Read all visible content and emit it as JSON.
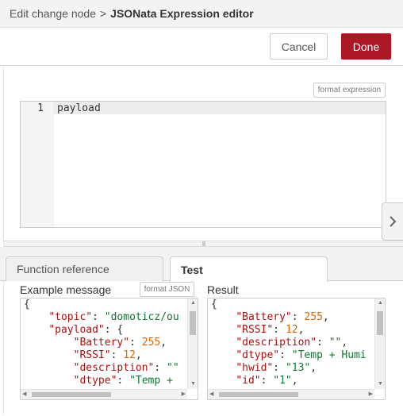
{
  "breadcrumb": {
    "parent": "Edit change node",
    "separator": ">",
    "current": "JSONata Expression editor"
  },
  "toolbar": {
    "cancel_label": "Cancel",
    "done_label": "Done"
  },
  "expression": {
    "format_label": "format expression",
    "line_number": "1",
    "code": "payload"
  },
  "tabs": [
    {
      "label": "Function reference",
      "active": false
    },
    {
      "label": "Test",
      "active": true
    }
  ],
  "test": {
    "example_label": "Example message",
    "format_json_label": "format JSON",
    "result_label": "Result",
    "example_lines": [
      [
        {
          "t": "p",
          "v": "{"
        }
      ],
      [
        {
          "t": "p",
          "v": "    "
        },
        {
          "t": "k",
          "v": "\"topic\""
        },
        {
          "t": "p",
          "v": ": "
        },
        {
          "t": "s",
          "v": "\"domoticz/ou"
        }
      ],
      [
        {
          "t": "p",
          "v": "    "
        },
        {
          "t": "k",
          "v": "\"payload\""
        },
        {
          "t": "p",
          "v": ": {"
        }
      ],
      [
        {
          "t": "p",
          "v": "        "
        },
        {
          "t": "k",
          "v": "\"Battery\""
        },
        {
          "t": "p",
          "v": ": "
        },
        {
          "t": "n",
          "v": "255"
        },
        {
          "t": "p",
          "v": ","
        }
      ],
      [
        {
          "t": "p",
          "v": "        "
        },
        {
          "t": "k",
          "v": "\"RSSI\""
        },
        {
          "t": "p",
          "v": ": "
        },
        {
          "t": "n",
          "v": "12"
        },
        {
          "t": "p",
          "v": ","
        }
      ],
      [
        {
          "t": "p",
          "v": "        "
        },
        {
          "t": "k",
          "v": "\"description\""
        },
        {
          "t": "p",
          "v": ": "
        },
        {
          "t": "s",
          "v": "\"\""
        }
      ],
      [
        {
          "t": "p",
          "v": "        "
        },
        {
          "t": "k",
          "v": "\"dtype\""
        },
        {
          "t": "p",
          "v": ": "
        },
        {
          "t": "s",
          "v": "\"Temp + "
        }
      ]
    ],
    "result_lines": [
      [
        {
          "t": "p",
          "v": "{"
        }
      ],
      [
        {
          "t": "p",
          "v": "    "
        },
        {
          "t": "k",
          "v": "\"Battery\""
        },
        {
          "t": "p",
          "v": ": "
        },
        {
          "t": "n",
          "v": "255"
        },
        {
          "t": "p",
          "v": ","
        }
      ],
      [
        {
          "t": "p",
          "v": "    "
        },
        {
          "t": "k",
          "v": "\"RSSI\""
        },
        {
          "t": "p",
          "v": ": "
        },
        {
          "t": "n",
          "v": "12"
        },
        {
          "t": "p",
          "v": ","
        }
      ],
      [
        {
          "t": "p",
          "v": "    "
        },
        {
          "t": "k",
          "v": "\"description\""
        },
        {
          "t": "p",
          "v": ": "
        },
        {
          "t": "s",
          "v": "\"\""
        },
        {
          "t": "p",
          "v": ","
        }
      ],
      [
        {
          "t": "p",
          "v": "    "
        },
        {
          "t": "k",
          "v": "\"dtype\""
        },
        {
          "t": "p",
          "v": ": "
        },
        {
          "t": "s",
          "v": "\"Temp + Humi"
        }
      ],
      [
        {
          "t": "p",
          "v": "    "
        },
        {
          "t": "k",
          "v": "\"hwid\""
        },
        {
          "t": "p",
          "v": ": "
        },
        {
          "t": "s",
          "v": "\"13\""
        },
        {
          "t": "p",
          "v": ","
        }
      ],
      [
        {
          "t": "p",
          "v": "    "
        },
        {
          "t": "k",
          "v": "\"id\""
        },
        {
          "t": "p",
          "v": ": "
        },
        {
          "t": "s",
          "v": "\"1\""
        },
        {
          "t": "p",
          "v": ","
        }
      ]
    ]
  },
  "icons": {
    "side_toggle": "chevron-right-icon",
    "scroll_up": "arrow-up-icon",
    "scroll_down": "arrow-down-icon",
    "scroll_left": "arrow-left-icon",
    "scroll_right": "arrow-right-icon"
  },
  "colors": {
    "accent": "#ad1625",
    "key": "#aa1111",
    "string": "#117733",
    "number": "#dd6600"
  }
}
